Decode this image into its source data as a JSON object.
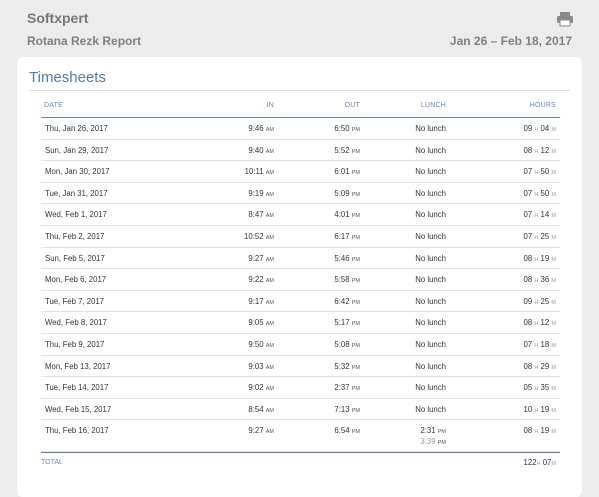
{
  "header": {
    "company": "Softxpert",
    "report_title": "Rotana Rezk Report",
    "date_range": "Jan 26 – Feb 18, 2017",
    "print_icon": "printer-icon"
  },
  "section": {
    "title": "Timesheets"
  },
  "columns": {
    "date": "DATE",
    "in": "IN",
    "out": "OUT",
    "lunch": "LUNCH",
    "hours": "HOURS"
  },
  "rows": [
    {
      "date": "Thu, Jan 26, 2017",
      "in": "9:46",
      "in_p": "AM",
      "out": "6:50",
      "out_p": "PM",
      "lunch": "No lunch",
      "h": "09",
      "m": "04"
    },
    {
      "date": "Sun, Jan 29, 2017",
      "in": "9:40",
      "in_p": "AM",
      "out": "5:52",
      "out_p": "PM",
      "lunch": "No lunch",
      "h": "08",
      "m": "12"
    },
    {
      "date": "Mon, Jan 30, 2017",
      "in": "10:11",
      "in_p": "AM",
      "out": "6:01",
      "out_p": "PM",
      "lunch": "No lunch",
      "h": "07",
      "m": "50"
    },
    {
      "date": "Tue, Jan 31, 2017",
      "in": "9:19",
      "in_p": "AM",
      "out": "5:09",
      "out_p": "PM",
      "lunch": "No lunch",
      "h": "07",
      "m": "50"
    },
    {
      "date": "Wed, Feb 1, 2017",
      "in": "8:47",
      "in_p": "AM",
      "out": "4:01",
      "out_p": "PM",
      "lunch": "No lunch",
      "h": "07",
      "m": "14"
    },
    {
      "date": "Thu, Feb 2, 2017",
      "in": "10:52",
      "in_p": "AM",
      "out": "6:17",
      "out_p": "PM",
      "lunch": "No lunch",
      "h": "07",
      "m": "25"
    },
    {
      "date": "Sun, Feb 5, 2017",
      "in": "9:27",
      "in_p": "AM",
      "out": "5:46",
      "out_p": "PM",
      "lunch": "No lunch",
      "h": "08",
      "m": "19"
    },
    {
      "date": "Mon, Feb 6, 2017",
      "in": "9:22",
      "in_p": "AM",
      "out": "5:58",
      "out_p": "PM",
      "lunch": "No lunch",
      "h": "08",
      "m": "36"
    },
    {
      "date": "Tue, Feb 7, 2017",
      "in": "9:17",
      "in_p": "AM",
      "out": "6:42",
      "out_p": "PM",
      "lunch": "No lunch",
      "h": "09",
      "m": "25"
    },
    {
      "date": "Wed, Feb 8, 2017",
      "in": "9:05",
      "in_p": "AM",
      "out": "5:17",
      "out_p": "PM",
      "lunch": "No lunch",
      "h": "08",
      "m": "12"
    },
    {
      "date": "Thu, Feb 9, 2017",
      "in": "9:50",
      "in_p": "AM",
      "out": "5:08",
      "out_p": "PM",
      "lunch": "No lunch",
      "h": "07",
      "m": "18"
    },
    {
      "date": "Mon, Feb 13, 2017",
      "in": "9:03",
      "in_p": "AM",
      "out": "5:32",
      "out_p": "PM",
      "lunch": "No lunch",
      "h": "08",
      "m": "29"
    },
    {
      "date": "Tue, Feb 14, 2017",
      "in": "9:02",
      "in_p": "AM",
      "out": "2:37",
      "out_p": "PM",
      "lunch": "No lunch",
      "h": "05",
      "m": "35"
    },
    {
      "date": "Wed, Feb 15, 2017",
      "in": "8:54",
      "in_p": "AM",
      "out": "7:13",
      "out_p": "PM",
      "lunch": "No lunch",
      "h": "10",
      "m": "19"
    },
    {
      "date": "Thu, Feb 16, 2017",
      "in": "9:27",
      "in_p": "AM",
      "out": "6:54",
      "out_p": "PM",
      "lunch": "2:31",
      "lunch_p": "PM",
      "lunch2": "3:39",
      "lunch2_p": "PM",
      "h": "08",
      "m": "19"
    }
  ],
  "total": {
    "label": "TOTAL",
    "h": "122",
    "m": "07"
  },
  "units": {
    "h": "H",
    "m": "M"
  }
}
